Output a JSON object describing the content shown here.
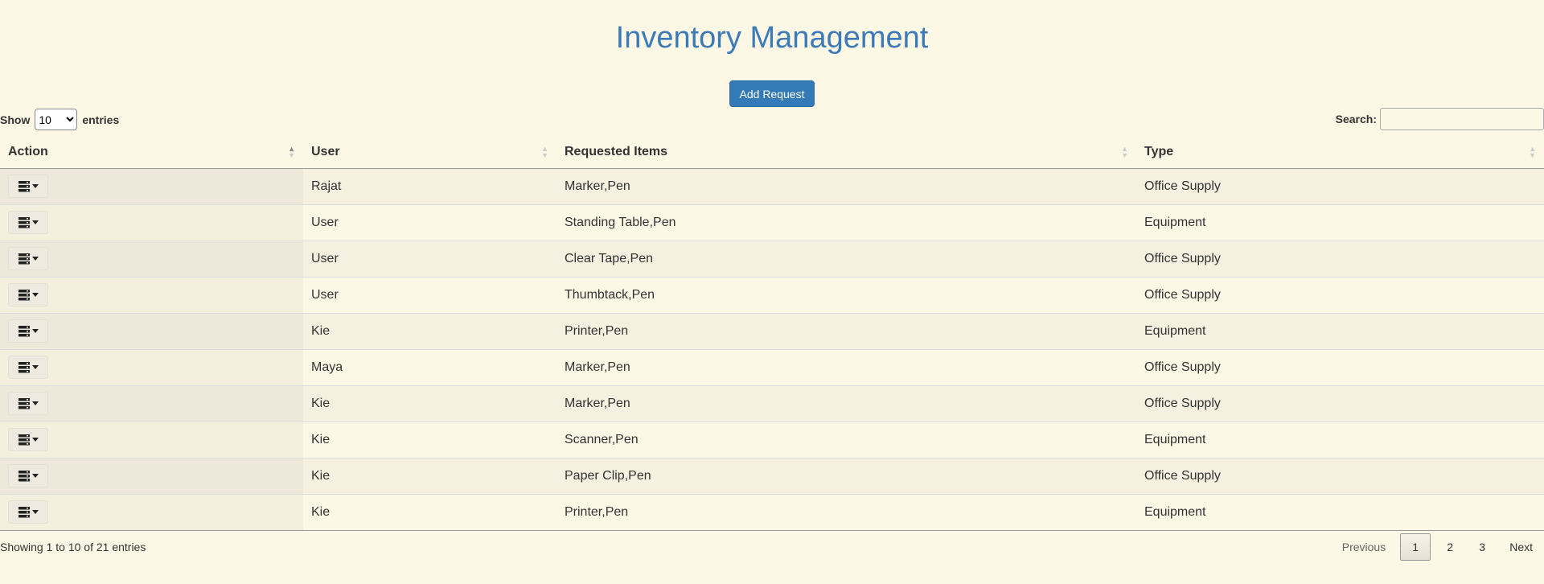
{
  "header": {
    "title": "Inventory Management"
  },
  "toolbar": {
    "add_label": "Add Request"
  },
  "length": {
    "show": "Show",
    "value": "10",
    "options": [
      "10"
    ],
    "entries": "entries"
  },
  "search": {
    "label": "Search:",
    "value": "",
    "placeholder": ""
  },
  "table": {
    "columns": [
      "Action",
      "User",
      "Requested Items",
      "Type"
    ],
    "rows": [
      {
        "user": "Rajat",
        "items": "Marker,Pen",
        "type": "Office Supply"
      },
      {
        "user": "User",
        "items": "Standing Table,Pen",
        "type": "Equipment"
      },
      {
        "user": "User",
        "items": "Clear Tape,Pen",
        "type": "Office Supply"
      },
      {
        "user": "User",
        "items": "Thumbtack,Pen",
        "type": "Office Supply"
      },
      {
        "user": "Kie",
        "items": "Printer,Pen",
        "type": "Equipment"
      },
      {
        "user": "Maya",
        "items": "Marker,Pen",
        "type": "Office Supply"
      },
      {
        "user": "Kie",
        "items": "Marker,Pen",
        "type": "Office Supply"
      },
      {
        "user": "Kie",
        "items": "Scanner,Pen",
        "type": "Equipment"
      },
      {
        "user": "Kie",
        "items": "Paper Clip,Pen",
        "type": "Office Supply"
      },
      {
        "user": "Kie",
        "items": "Printer,Pen",
        "type": "Equipment"
      }
    ]
  },
  "footer": {
    "info": "Showing 1 to 10 of 21 entries",
    "previous": "Previous",
    "pages": [
      "1",
      "2",
      "3"
    ],
    "next": "Next"
  },
  "icons": {
    "action": "server-dropdown-icon"
  },
  "colors": {
    "title": "#3c7ab8",
    "primary_button": "#337ab7",
    "background": "#fdf7e6"
  }
}
